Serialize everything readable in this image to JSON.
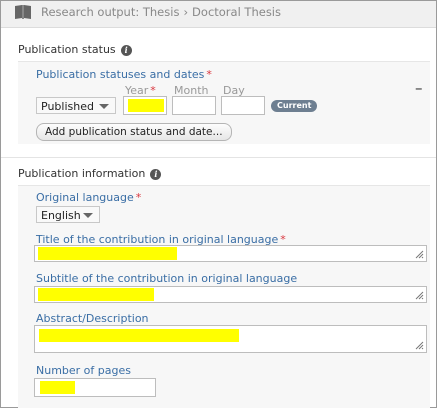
{
  "breadcrumb": {
    "part1": "Research output: Thesis",
    "separator": "›",
    "part2": "Doctoral Thesis"
  },
  "publication_status": {
    "section_title": "Publication status",
    "group_label": "Publication statuses and dates",
    "required_mark": "*",
    "status_select_value": "Published",
    "year_label": "Year",
    "month_label": "Month",
    "day_label": "Day",
    "current_badge": "Current",
    "remove_label": "–",
    "add_button": "Add publication status and date..."
  },
  "publication_information": {
    "section_title": "Publication information",
    "original_language_label": "Original language",
    "original_language_value": "English",
    "title_label": "Title of the contribution in original language",
    "subtitle_label": "Subtitle of the contribution in original language",
    "abstract_label": "Abstract/Description",
    "pages_label": "Number of pages",
    "required_mark": "*"
  },
  "icons": {
    "info": "i",
    "book": "book-icon",
    "info_icon": "info-icon",
    "caret": "chevron-down-icon",
    "resize": "resize-grip-icon"
  },
  "colors": {
    "label_blue": "#3a6ea5",
    "required_red": "#d9363e",
    "highlight": "#ffff00",
    "badge": "#6e7f91"
  }
}
